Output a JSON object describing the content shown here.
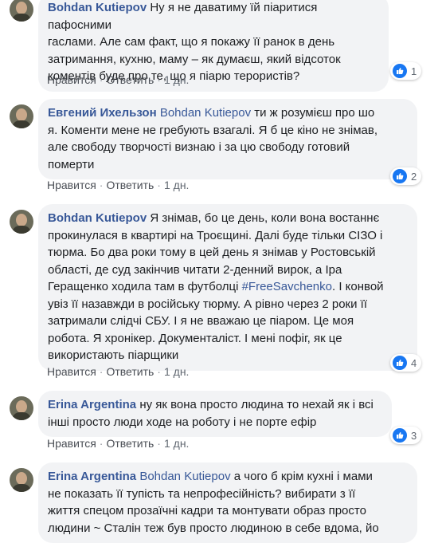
{
  "colors": {
    "link": "#385898",
    "like": "#1877f2",
    "bubble": "#f2f3f5"
  },
  "actions": {
    "like": "Нравится",
    "reply": "Ответить",
    "separator": "·"
  },
  "comments": [
    {
      "author": "Bohdan Kutiepov",
      "lines": [
        "Ну я не даватиму їй піаритися пафосними",
        "гаслами. Але сам факт, що я покажу її ранок в день",
        "затримання, кухню, маму – як думаєш, який відсоток",
        "коментів буде про те, що я піарю терористів?"
      ],
      "time": "1 дн.",
      "reactions": "1"
    },
    {
      "author": "Евгений Ихельзон",
      "mention": "Bohdan Kutiepov",
      "lines": [
        "ти ж розумієш про шо",
        "я. Коменти мене не гребують взагалі. Я б це кіно не знімав,",
        "але свободу творчості визнаю і за цю свободу готовий",
        "померти"
      ],
      "time": "1 дн.",
      "reactions": "2"
    },
    {
      "author": "Bohdan Kutiepov",
      "lines": [
        "Я знімав, бо це день, коли вона востаннє",
        "прокинулася в квартирі на Троєщині. Далі буде тільки СІЗО і",
        "тюрма. Бо два роки тому в цей день я знімав у Ростовській",
        "області, де суд закінчив читати 2-денний вирок, а Іра",
        "Геращенко ходила там в футболці",
        "увіз її назавжди в російську тюрму. А рівно через 2 роки її",
        "затримали слідчі СБУ. І я не вважаю це піаром. Це моя",
        "робота. Я хронікер. Документаліст. І мені пофіг, як це",
        "використають піарщики"
      ],
      "hashtag": "#FreeSavchenko",
      "hashtag_after": ". І конвой",
      "time": "1 дн.",
      "reactions": "4"
    },
    {
      "author": "Erina Argentina",
      "lines": [
        "ну як вона просто людина то нехай як і всі",
        "інші просто люди ходе на роботу і не порте ефір"
      ],
      "time": "1 дн.",
      "reactions": "3"
    },
    {
      "author": "Erina Argentina",
      "mention": "Bohdan Kutiepov",
      "lines": [
        "а чого б крім кухні і мами",
        "не показать її тупість та непрофесійність? вибирати з її",
        "життя спецом прозаїчні кадри та монтувати образ просто",
        "людини ~ Сталін теж був просто людиною в себе вдома, йо"
      ],
      "time": "",
      "reactions": ""
    }
  ]
}
